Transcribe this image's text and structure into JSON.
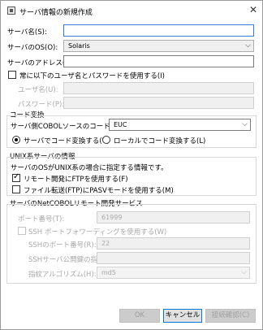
{
  "window": {
    "title": "サーバ情報の新規作成",
    "close_glyph": "✕"
  },
  "server_name": {
    "label": "サーバ名(S):",
    "value": ""
  },
  "server_os": {
    "label": "サーバのOS(O):",
    "value": "Solaris"
  },
  "server_address": {
    "label": "サーバのアドレス(A):",
    "value": ""
  },
  "always_use_credentials": {
    "label": "常に以下のユーザ名とパスワードを使用する(I)",
    "checked": false
  },
  "username": {
    "label": "ユーザ名(U):",
    "value": ""
  },
  "password": {
    "label": "パスワード(P):",
    "value": ""
  },
  "code_conversion": {
    "group_title": "コード変換",
    "server_code_label": "サーバ側COBOLソースのコード系(E):",
    "server_code_value": "EUC",
    "radio_server": "サーバでコード変換する(V)",
    "radio_local": "ローカルでコード変換する(L)",
    "selected": "server"
  },
  "unix_info": {
    "group_title": "UNIX系サーバの情報",
    "description": "サーバのOSがUNIX系の場合に指定する情報です。",
    "remote_ftp": {
      "label": "リモート開発にFTPを使用する(F)",
      "checked": true
    },
    "pasv_mode": {
      "label": "ファイル転送(FTP)にPASVモードを使用する(M)",
      "checked": false
    }
  },
  "netcobol": {
    "group_title": "サーバのNetCOBOLリモート開発サービス",
    "port_label": "ポート番号(T):",
    "port_value": "61999",
    "ssh_forward": {
      "label": "SSH ポートフォワーディングを使用する(W)",
      "checked": false
    },
    "ssh_port_label": "SSHのポート番号(R):",
    "ssh_port_value": "22",
    "ssh_key_label": "SSHサーバ公開鍵の指紋(G):",
    "ssh_key_value": "",
    "hash_label": "指紋アルゴリズム(H):",
    "hash_value": "md5"
  },
  "buttons": {
    "ok": "OK",
    "cancel": "キャンセル",
    "test": "接続確認(C)"
  },
  "colors": {
    "accent": "#0078d7",
    "focus_border": "#3a78d8",
    "disabled_text": "#a8a8a8"
  }
}
